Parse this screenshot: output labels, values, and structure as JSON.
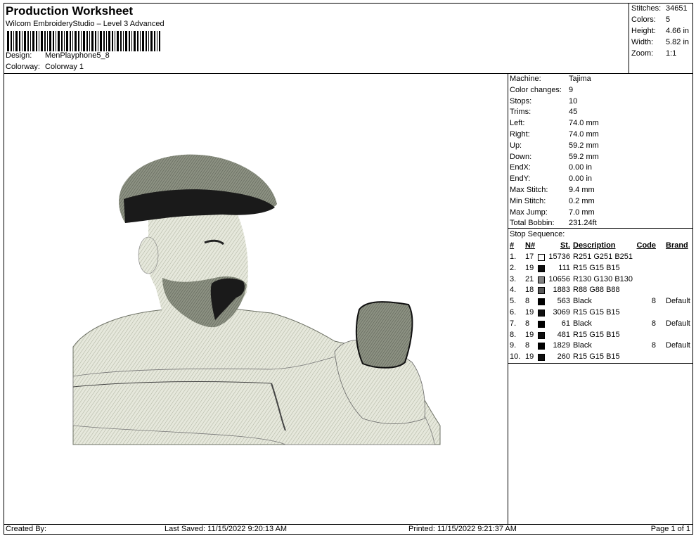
{
  "header": {
    "title": "Production Worksheet",
    "subtitle": "Wilcom EmbroideryStudio – Level 3 Advanced",
    "design_label": "Design:",
    "design_value": "MenPlayphone5_8",
    "colorway_label": "Colorway:",
    "colorway_value": "Colorway 1"
  },
  "summary": {
    "stitches_label": "Stitches:",
    "stitches_value": "34651",
    "colors_label": "Colors:",
    "colors_value": "5",
    "height_label": "Height:",
    "height_value": "4.66 in",
    "width_label": "Width:",
    "width_value": "5.82 in",
    "zoom_label": "Zoom:",
    "zoom_value": "1:1"
  },
  "info": {
    "rows": [
      {
        "label": "Machine:",
        "value": "Tajima"
      },
      {
        "label": "Color changes:",
        "value": "9"
      },
      {
        "label": "Stops:",
        "value": "10"
      },
      {
        "label": "Trims:",
        "value": "45"
      },
      {
        "label": "Left:",
        "value": "74.0 mm"
      },
      {
        "label": "Right:",
        "value": "74.0 mm"
      },
      {
        "label": "Up:",
        "value": "59.2 mm"
      },
      {
        "label": "Down:",
        "value": "59.2 mm"
      },
      {
        "label": "EndX:",
        "value": "0.00 in"
      },
      {
        "label": "EndY:",
        "value": "0.00 in"
      },
      {
        "label": "Max Stitch:",
        "value": "9.4 mm"
      },
      {
        "label": "Min Stitch:",
        "value": "0.2 mm"
      },
      {
        "label": "Max Jump:",
        "value": "7.0 mm"
      },
      {
        "label": "Total Bobbin:",
        "value": "231.24ft"
      }
    ]
  },
  "stop_sequence": {
    "title": "Stop Sequence:",
    "columns": {
      "num": "#",
      "needle": "N#",
      "stitches": "St.",
      "description": "Description",
      "code": "Code",
      "brand": "Brand"
    },
    "rows": [
      {
        "num": "1.",
        "needle": "17",
        "color": "#fbfbfb",
        "stitches": "15736",
        "description": "R251 G251 B251",
        "code": "",
        "brand": ""
      },
      {
        "num": "2.",
        "needle": "19",
        "color": "#0f0f0f",
        "stitches": "111",
        "description": "R15 G15 B15",
        "code": "",
        "brand": ""
      },
      {
        "num": "3.",
        "needle": "21",
        "color": "#828282",
        "stitches": "10656",
        "description": "R130 G130 B130",
        "code": "",
        "brand": ""
      },
      {
        "num": "4.",
        "needle": "18",
        "color": "#585858",
        "stitches": "1883",
        "description": "R88 G88 B88",
        "code": "",
        "brand": ""
      },
      {
        "num": "5.",
        "needle": "8",
        "color": "#000000",
        "stitches": "563",
        "description": "Black",
        "code": "8",
        "brand": "Default"
      },
      {
        "num": "6.",
        "needle": "19",
        "color": "#0f0f0f",
        "stitches": "3069",
        "description": "R15 G15 B15",
        "code": "",
        "brand": ""
      },
      {
        "num": "7.",
        "needle": "8",
        "color": "#000000",
        "stitches": "61",
        "description": "Black",
        "code": "8",
        "brand": "Default"
      },
      {
        "num": "8.",
        "needle": "19",
        "color": "#0f0f0f",
        "stitches": "481",
        "description": "R15 G15 B15",
        "code": "",
        "brand": ""
      },
      {
        "num": "9.",
        "needle": "8",
        "color": "#000000",
        "stitches": "1829",
        "description": "Black",
        "code": "8",
        "brand": "Default"
      },
      {
        "num": "10.",
        "needle": "19",
        "color": "#0f0f0f",
        "stitches": "260",
        "description": "R15 G15 B15",
        "code": "",
        "brand": ""
      }
    ]
  },
  "footer": {
    "created_by": "Created By:",
    "last_saved": "Last Saved: 11/15/2022 9:20:13 AM",
    "printed": "Printed: 11/15/2022 9:21:37 AM",
    "page": "Page 1 of 1"
  }
}
